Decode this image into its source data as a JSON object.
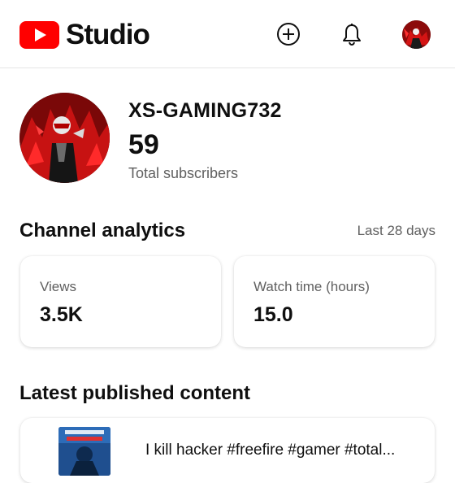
{
  "header": {
    "logo_text": "Studio",
    "brand_color": "#ff0000",
    "icons": [
      "create-icon",
      "notifications-bell-icon",
      "account-avatar"
    ]
  },
  "channel": {
    "name": "XS-GAMING732",
    "subscriber_count": "59",
    "subscriber_label": "Total subscribers"
  },
  "analytics": {
    "title": "Channel analytics",
    "period": "Last 28 days",
    "cards": [
      {
        "label": "Views",
        "value": "3.5K"
      },
      {
        "label": "Watch time (hours)",
        "value": "15.0"
      }
    ]
  },
  "latest": {
    "title": "Latest published content",
    "video_title": "I kill hacker #freefire #gamer #total..."
  }
}
